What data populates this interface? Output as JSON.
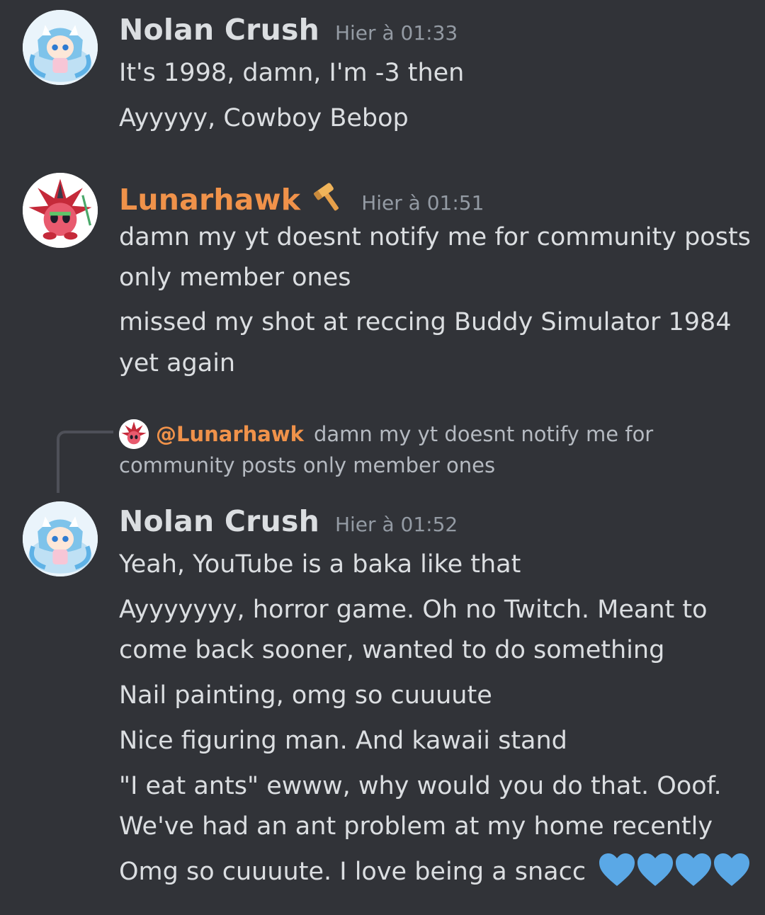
{
  "messages": [
    {
      "author": "Nolan Crush",
      "timestamp": "Hier à 01:33",
      "lines": [
        "It's 1998, damn, I'm -3 then",
        "Ayyyyy, Cowboy Bebop"
      ]
    },
    {
      "author": "Lunarhawk",
      "timestamp": "Hier à 01:51",
      "role_icon": "hammer-icon",
      "lines": [
        "damn my yt doesnt notify me for community posts",
        "only member ones",
        "missed my shot at reccing Buddy Simulator 1984",
        "yet again"
      ]
    },
    {
      "reply": {
        "mention": "@Lunarhawk",
        "text_line1": "damn my yt doesnt notify me for",
        "text_line2": "community posts only member ones"
      },
      "author": "Nolan Crush",
      "timestamp": "Hier à 01:52",
      "lines": [
        "Yeah, YouTube is a baka like that",
        "Ayyyyyyy, horror game. Oh no Twitch. Meant to",
        "come back sooner, wanted to do something",
        "Nail painting, omg so cuuuute",
        "Nice figuring man. And kawaii stand",
        "\"I eat ants\" ewww, why would you do that. Ooof.",
        "We've had an ant problem at my home recently",
        "Omg so cuuuute. I love being a snacc"
      ],
      "emoji": [
        "blue-heart-icon",
        "blue-heart-icon",
        "blue-heart-icon",
        "blue-heart-icon"
      ]
    }
  ],
  "colors": {
    "background": "#313338",
    "text": "#dbdee1",
    "muted": "#949ba4",
    "lunarhawk_role": "#f0924a",
    "heart": "#5aa8e6"
  }
}
